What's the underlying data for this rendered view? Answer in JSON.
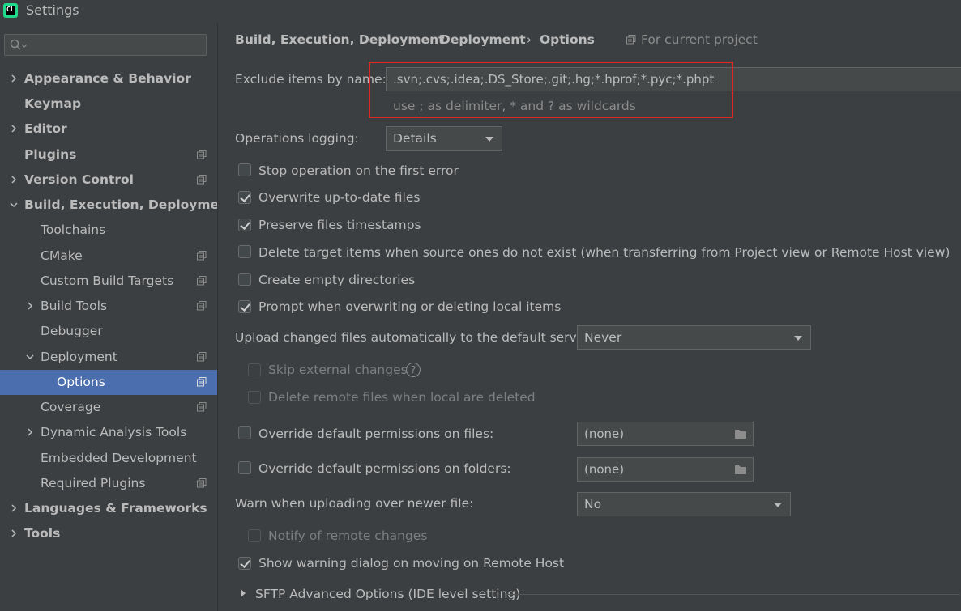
{
  "window": {
    "title": "Settings",
    "app_icon_text": "CL"
  },
  "search": {
    "placeholder": ""
  },
  "sidebar": {
    "items": [
      {
        "label": "Appearance & Behavior"
      },
      {
        "label": "Keymap"
      },
      {
        "label": "Editor"
      },
      {
        "label": "Plugins"
      },
      {
        "label": "Version Control"
      },
      {
        "label": "Build, Execution, Deployment"
      },
      {
        "label": "Toolchains"
      },
      {
        "label": "CMake"
      },
      {
        "label": "Custom Build Targets"
      },
      {
        "label": "Build Tools"
      },
      {
        "label": "Debugger"
      },
      {
        "label": "Deployment"
      },
      {
        "label": "Options"
      },
      {
        "label": "Coverage"
      },
      {
        "label": "Dynamic Analysis Tools"
      },
      {
        "label": "Embedded Development"
      },
      {
        "label": "Required Plugins"
      },
      {
        "label": "Languages & Frameworks"
      },
      {
        "label": "Tools"
      }
    ]
  },
  "breadcrumb": {
    "part1": "Build, Execution, Deployment",
    "part2": "Deployment",
    "part3": "Options",
    "separator": "›",
    "scope": "For current project"
  },
  "form": {
    "exclude_label": "Exclude items by name:",
    "exclude_value": ".svn;.cvs;.idea;.DS_Store;.git;.hg;*.hprof;*.pyc;*.phpt",
    "exclude_hint": "use ; as delimiter, * and ? as wildcards",
    "ops_logging_label": "Operations logging:",
    "ops_logging_value": "Details",
    "stop_on_error": "Stop operation on the first error",
    "overwrite_uptodate": "Overwrite up-to-date files",
    "preserve_timestamps": "Preserve files timestamps",
    "delete_target": "Delete target items when source ones do not exist (when transferring from Project view or Remote Host view)",
    "create_empty_dirs": "Create empty directories",
    "prompt_overwrite": "Prompt when overwriting or deleting local items",
    "upload_label": "Upload changed files automatically to the default server",
    "upload_value": "Never",
    "skip_external": "Skip external changes",
    "help_glyph": "?",
    "delete_remote": "Delete remote files when local are deleted",
    "override_files_label": "Override default permissions on files:",
    "override_files_value": "(none)",
    "override_folders_label": "Override default permissions on folders:",
    "override_folders_value": "(none)",
    "warn_upload_label": "Warn when uploading over newer file:",
    "warn_upload_value": "No",
    "notify_remote": "Notify of remote changes",
    "show_warning": "Show warning dialog on moving on Remote Host",
    "sftp_advanced": "SFTP Advanced Options (IDE level setting)"
  },
  "checkboxes": {
    "stop_on_error": false,
    "overwrite_uptodate": true,
    "preserve_timestamps": true,
    "delete_target": false,
    "create_empty_dirs": false,
    "prompt_overwrite": true,
    "skip_external": false,
    "delete_remote": false,
    "override_files": false,
    "override_folders": false,
    "notify_remote": false,
    "show_warning": true
  },
  "colors": {
    "background": "#3c3f41",
    "selection": "#4b6eaf",
    "highlight_box": "#e02525",
    "text": "#bbbbbb"
  }
}
